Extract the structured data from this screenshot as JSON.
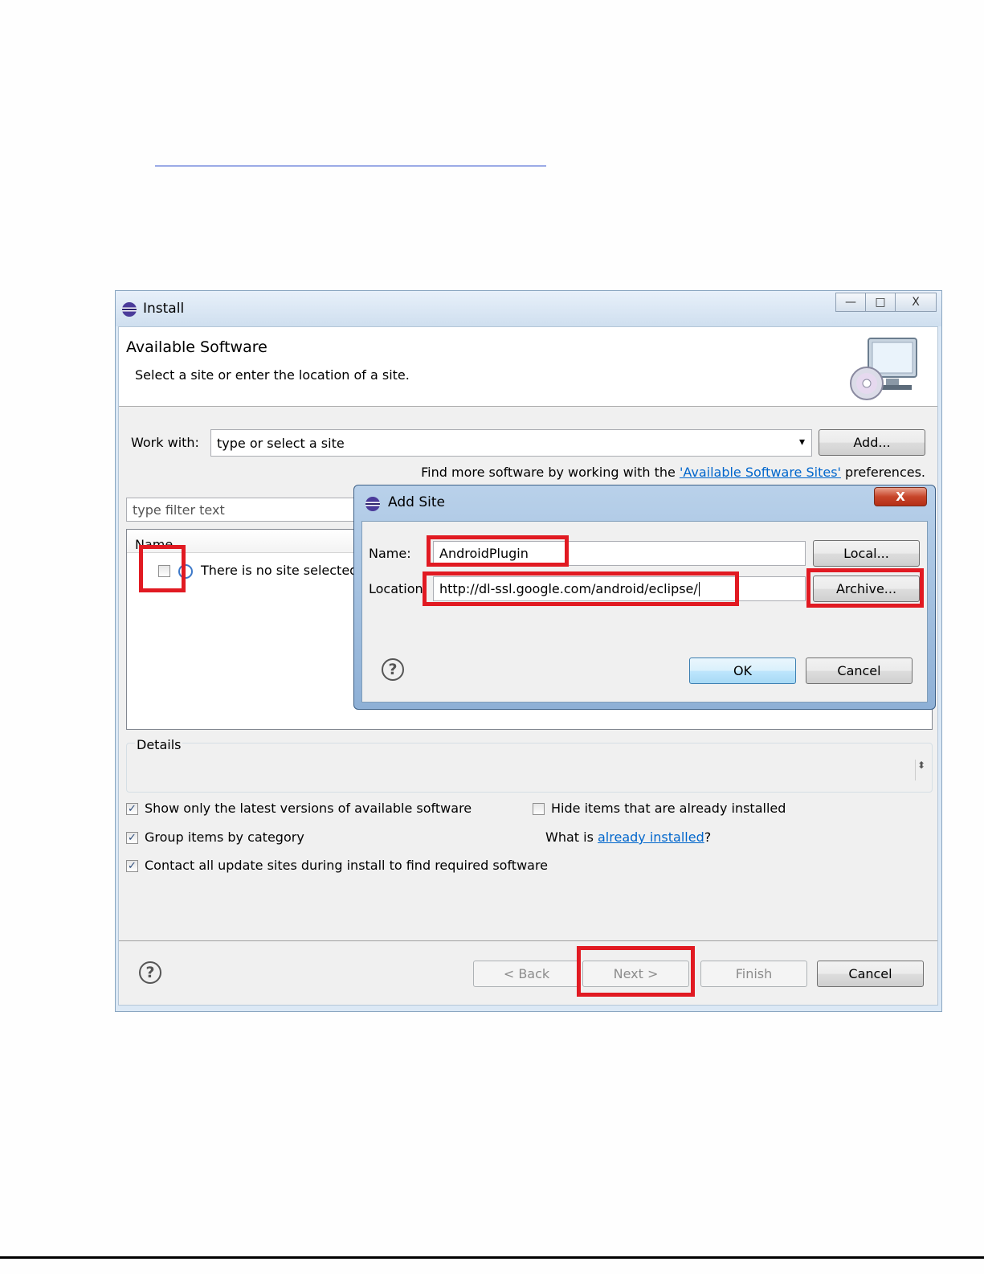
{
  "install_window": {
    "title": "Install",
    "header": {
      "title": "Available Software",
      "subtitle": "Select a site or enter the location of a site."
    },
    "work_with": {
      "label": "Work with:",
      "placeholder": "type or select a site",
      "add_button": "Add..."
    },
    "find_more": {
      "prefix": "Find more software by working with the ",
      "link": "'Available Software Sites'",
      "suffix": " preferences."
    },
    "filter": {
      "placeholder": "type filter text"
    },
    "tree": {
      "column_header": "Name",
      "items": [
        {
          "label": "There is no site selected.",
          "checked": false
        }
      ]
    },
    "details": {
      "label": "Details"
    },
    "options": {
      "show_latest": {
        "label": "Show only the latest versions of available software",
        "checked": true
      },
      "group_by_category": {
        "label": "Group items by category",
        "checked": true
      },
      "contact_all_sites": {
        "label": "Contact all update sites during install to find required software",
        "checked": true
      },
      "hide_installed": {
        "label": "Hide items that are already installed",
        "checked": false
      },
      "what_is_prefix": "What is ",
      "what_is_link": "already installed",
      "what_is_suffix": "?"
    },
    "buttons": {
      "back": "< Back",
      "next": "Next >",
      "finish": "Finish",
      "cancel": "Cancel"
    }
  },
  "add_site_dialog": {
    "title": "Add Site",
    "name_label": "Name:",
    "name_value": "AndroidPlugin",
    "location_label": "Location:",
    "location_value": "http://dl-ssl.google.com/android/eclipse/",
    "local_button": "Local...",
    "archive_button": "Archive...",
    "ok_button": "OK",
    "cancel_button": "Cancel"
  },
  "icons": {
    "help": "?",
    "dropdown": "▾",
    "checkmark": "✓",
    "close": "X",
    "minimize": "—",
    "maximize": "□"
  },
  "colors": {
    "highlight_box": "#e11a22",
    "link": "#0066cc"
  }
}
